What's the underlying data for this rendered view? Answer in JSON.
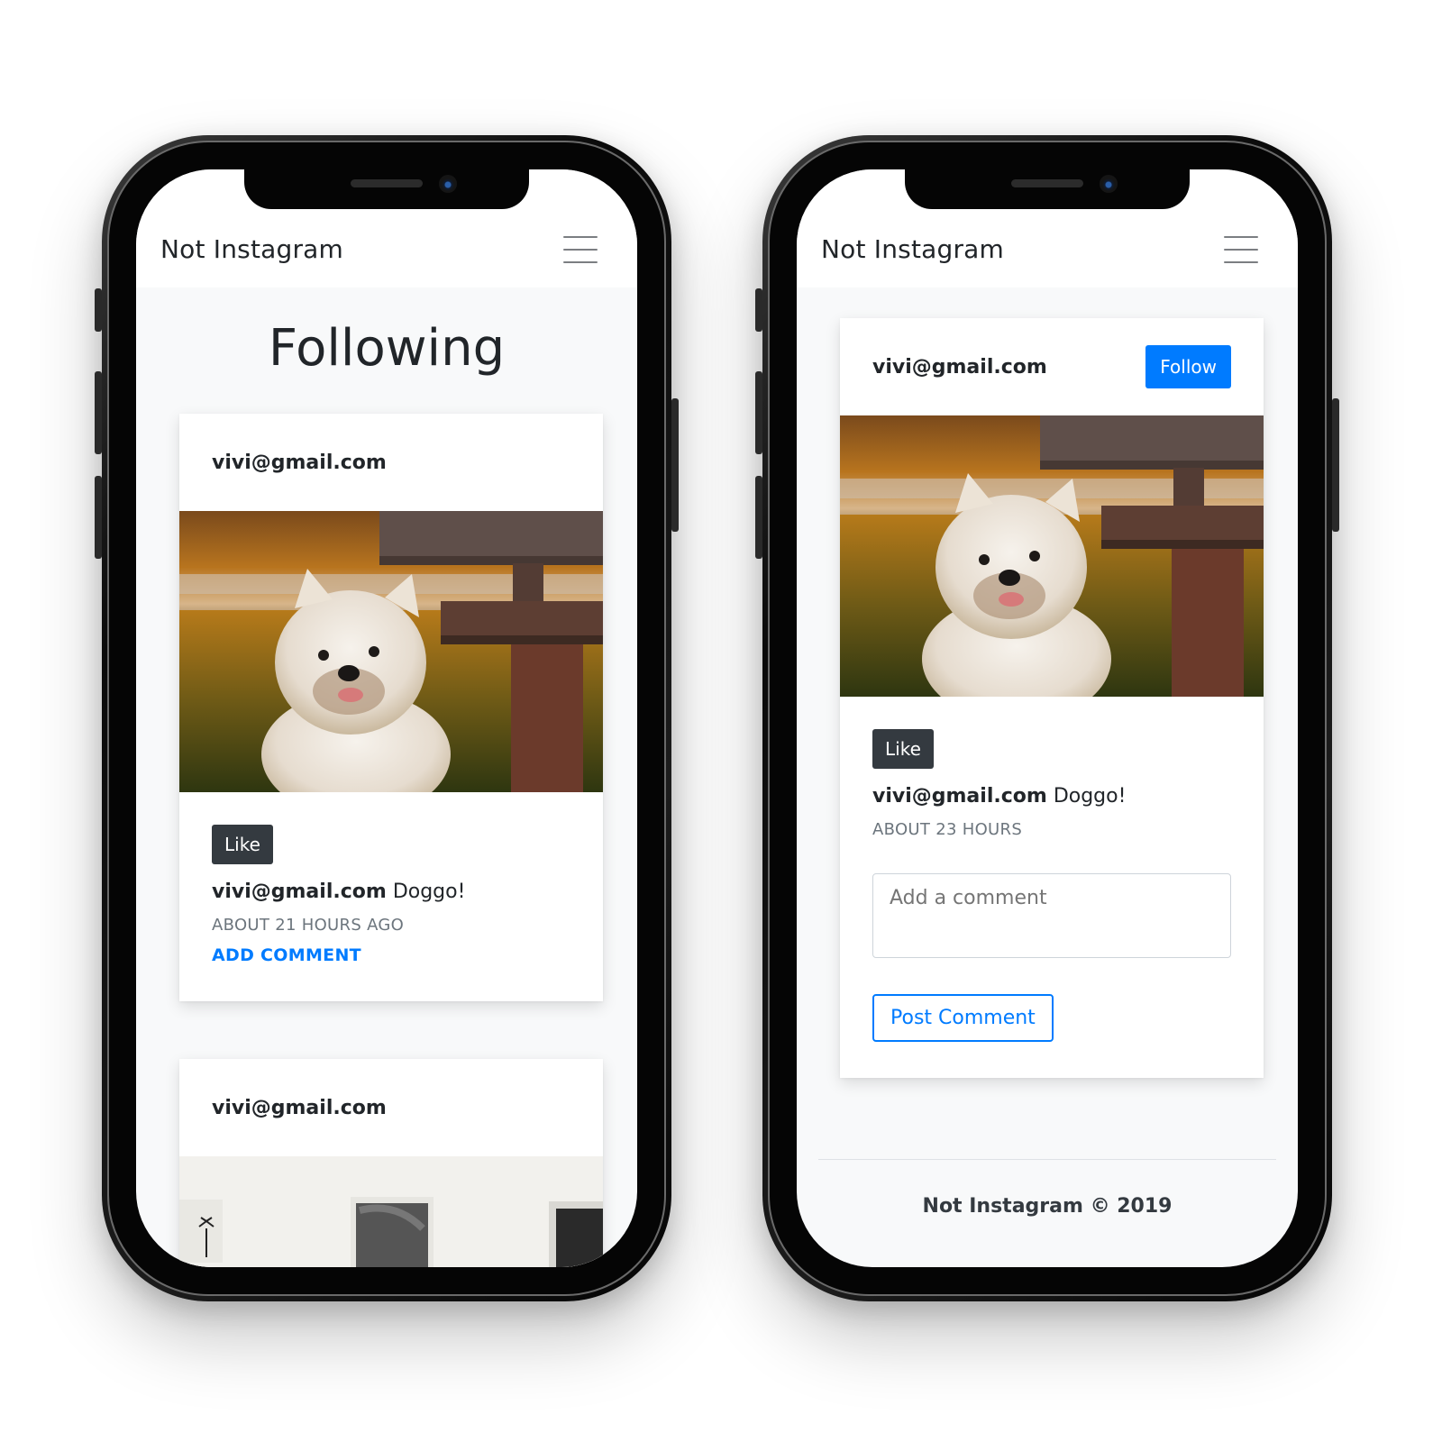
{
  "app": {
    "brand": "Not Instagram"
  },
  "left_screen": {
    "page_title": "Following",
    "posts": [
      {
        "username": "vivi@gmail.com",
        "like_label": "Like",
        "caption_user": "vivi@gmail.com",
        "caption_text": "Doggo!",
        "timestamp": "ABOUT 21 HOURS AGO",
        "add_comment_label": "ADD COMMENT"
      },
      {
        "username": "vivi@gmail.com"
      }
    ]
  },
  "right_screen": {
    "post": {
      "username": "vivi@gmail.com",
      "follow_label": "Follow",
      "like_label": "Like",
      "caption_user": "vivi@gmail.com",
      "caption_text": "Doggo!",
      "timestamp": "ABOUT 23 HOURS",
      "comment_placeholder": "Add a comment",
      "post_comment_label": "Post Comment"
    },
    "footer": "Not Instagram © 2019"
  },
  "colors": {
    "primary": "#007bff",
    "dark_button": "#343a40",
    "muted": "#6c757d",
    "page_bg": "#f8f9fa"
  },
  "icons": [
    "hamburger-menu-icon"
  ]
}
